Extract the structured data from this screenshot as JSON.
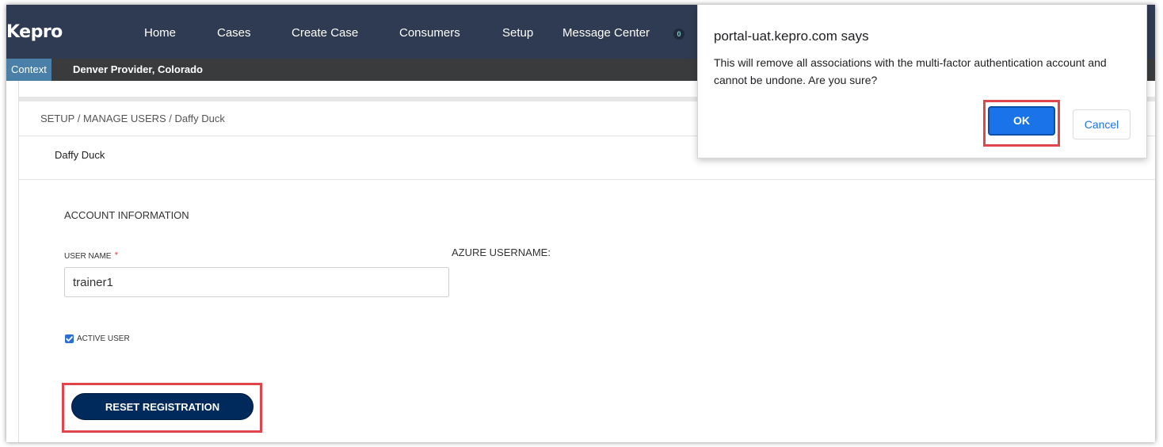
{
  "brand": {
    "logo_text": "Kepro"
  },
  "nav": {
    "items": [
      {
        "label": "Home"
      },
      {
        "label": "Cases"
      },
      {
        "label": "Create Case"
      },
      {
        "label": "Consumers"
      },
      {
        "label": "Setup"
      },
      {
        "label": "Message Center"
      }
    ],
    "message_badge": "0"
  },
  "context_bar": {
    "label": "Context",
    "value": "Denver Provider, Colorado"
  },
  "breadcrumb": "SETUP / MANAGE USERS / Daffy  Duck",
  "user_title": "Daffy  Duck",
  "account": {
    "section_heading": "ACCOUNT INFORMATION",
    "username_label": "USER NAME",
    "required_marker": "*",
    "username_value": "trainer1",
    "azure_label": "AZURE USERNAME:",
    "active_user_label": "ACTIVE USER",
    "active_user_checked": true,
    "reset_button_label": "RESET REGISTRATION"
  },
  "dialog": {
    "title": "portal-uat.kepro.com says",
    "message": "This will remove all associations with the multi-factor authentication account and cannot be undone. Are you sure?",
    "ok_label": "OK",
    "cancel_label": "Cancel"
  },
  "colors": {
    "nav_bg": "#2f3b52",
    "context_bg": "#3a3b3d",
    "context_label_bg": "#4a7fa8",
    "primary_button": "#002a5c",
    "dialog_ok": "#1a73e8",
    "highlight": "#e0464b",
    "checkbox": "#2c6fd1"
  }
}
